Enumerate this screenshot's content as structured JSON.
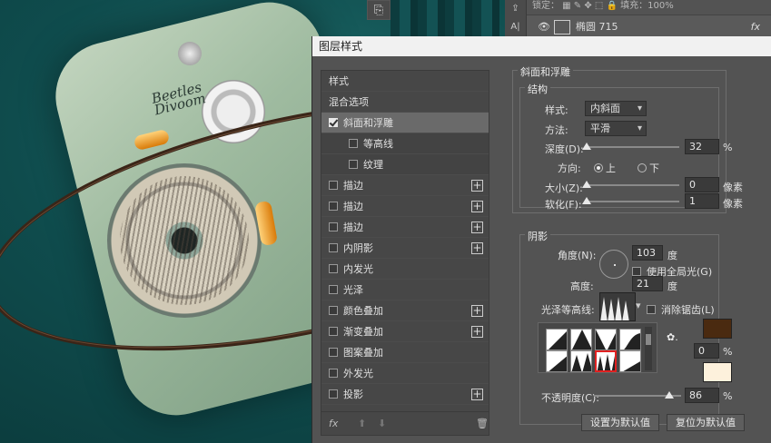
{
  "topbar": {
    "text": "锁定： ▦ ✎ ✥ ⬚ 🔒  填充：100%",
    "tool_glyph": "⎘"
  },
  "left_tools": {
    "glyph1": "⇪",
    "glyph2": "A|"
  },
  "layer": {
    "name": "椭圆 715",
    "fx": "fx"
  },
  "radio_art": {
    "brand_line1": "Beetles",
    "brand_line2": "Divoom"
  },
  "dialog": {
    "title": "图层样式",
    "styles_header": "样式",
    "blend_options": "混合选项",
    "items": [
      {
        "label": "斜面和浮雕",
        "checked": true,
        "selected": true,
        "sub": false,
        "plus": false
      },
      {
        "label": "等高线",
        "checked": false,
        "selected": false,
        "sub": true,
        "plus": false
      },
      {
        "label": "纹理",
        "checked": false,
        "selected": false,
        "sub": true,
        "plus": false
      },
      {
        "label": "描边",
        "checked": false,
        "selected": false,
        "sub": false,
        "plus": true
      },
      {
        "label": "描边",
        "checked": false,
        "selected": false,
        "sub": false,
        "plus": true
      },
      {
        "label": "描边",
        "checked": false,
        "selected": false,
        "sub": false,
        "plus": true
      },
      {
        "label": "内阴影",
        "checked": false,
        "selected": false,
        "sub": false,
        "plus": true
      },
      {
        "label": "内发光",
        "checked": false,
        "selected": false,
        "sub": false,
        "plus": false
      },
      {
        "label": "光泽",
        "checked": false,
        "selected": false,
        "sub": false,
        "plus": false
      },
      {
        "label": "颜色叠加",
        "checked": false,
        "selected": false,
        "sub": false,
        "plus": true
      },
      {
        "label": "渐变叠加",
        "checked": false,
        "selected": false,
        "sub": false,
        "plus": true
      },
      {
        "label": "图案叠加",
        "checked": false,
        "selected": false,
        "sub": false,
        "plus": false
      },
      {
        "label": "外发光",
        "checked": false,
        "selected": false,
        "sub": false,
        "plus": false
      },
      {
        "label": "投影",
        "checked": false,
        "selected": false,
        "sub": false,
        "plus": true
      }
    ],
    "footer": {
      "fx": "fx",
      "up": "⬆",
      "down": "⬇",
      "trash": "🗑"
    },
    "bevel": {
      "section": "斜面和浮雕",
      "structure": "结构",
      "style_label": "样式:",
      "style_value": "内斜面",
      "method_label": "方法:",
      "method_value": "平滑",
      "depth_label": "深度(D):",
      "depth_value": "32",
      "depth_unit": "%",
      "depth_level": 0.0,
      "direction_label": "方向:",
      "dir_up": "上",
      "dir_down": "下",
      "size_label": "大小(Z):",
      "size_value": "0",
      "size_unit": "像素",
      "size_level": 0.0,
      "soften_label": "软化(F):",
      "soften_value": "1",
      "soften_unit": "像素",
      "soften_level": 0.0
    },
    "shading": {
      "section": "阴影",
      "angle_label": "角度(N):",
      "angle_value": "103",
      "angle_unit": "度",
      "global_light": "使用全局光(G)",
      "altitude_label": "高度:",
      "altitude_value": "21",
      "altitude_unit": "度",
      "gloss_label": "光泽等高线:",
      "antialias": "消除锯齿(L)",
      "hl_opacity_value": "0",
      "hl_opacity_unit": "%",
      "opacity_label": "不透明度(C):",
      "opacity_value": "86",
      "opacity_unit": "%",
      "opacity_level": 0.86,
      "highlight_color": "#4a2a10",
      "shadow_color": "#fdf1dc",
      "gear": "✿."
    },
    "buttons": {
      "make_default": "设置为默认值",
      "reset_default": "复位为默认值"
    }
  }
}
